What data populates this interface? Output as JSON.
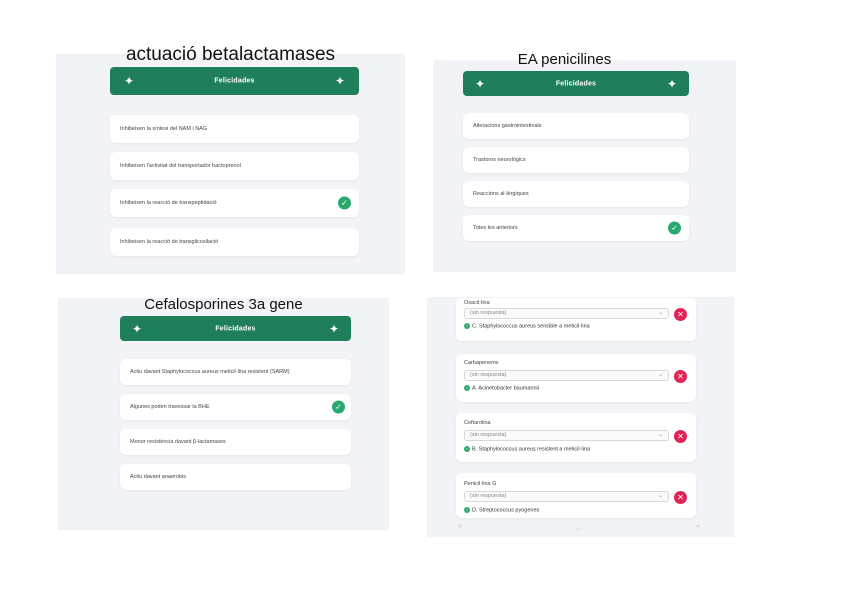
{
  "panel1": {
    "title": "actuació betalactamases",
    "banner": "Felicidades",
    "options": [
      {
        "text": "Inhibeixen la síntesi del NAM i NAG",
        "correct": false
      },
      {
        "text": "Inhibeixen l'activitat del transportador bactoprenol",
        "correct": false
      },
      {
        "text": "Inhibeixen la reacció de transpeptidació",
        "correct": true
      },
      {
        "text": "Inhibeixen la reacció de transglicosilació",
        "correct": false
      }
    ]
  },
  "panel2": {
    "title": "EA penicilines",
    "banner": "Felicidades",
    "options": [
      {
        "text": "Alteracions gastrointestinals",
        "correct": false
      },
      {
        "text": "Trastorns neurològics",
        "correct": false
      },
      {
        "text": "Reaccions al·lèrgiques",
        "correct": false
      },
      {
        "text": "Totes les anteriors",
        "correct": true
      }
    ]
  },
  "panel3": {
    "title": "Cefalosporines 3a gene",
    "banner": "Felicidades",
    "options": [
      {
        "text": "Actiu davant Staphylococcus aureus meticil·lina resistent (SARM)",
        "correct": false
      },
      {
        "text": "Algunes poden travessar la BHE",
        "correct": true
      },
      {
        "text": "Menor resistència davant β-lactamases",
        "correct": false
      },
      {
        "text": "Actiu davant anaerobis",
        "correct": false
      }
    ]
  },
  "panel4": {
    "placeholder": "(sin respuesta)",
    "questions": [
      {
        "label": "Oxacil·lina",
        "answer": "C. Staphylococcus aureus sensible a meticil·lina"
      },
      {
        "label": "Carbapenems",
        "answer": "A. Acinetobacter baumannii"
      },
      {
        "label": "Ceftarolina",
        "answer": "B. Staphylococcus aureus resistent a meticil·lina"
      },
      {
        "label": "Penicil·lina G",
        "answer": "D. Streptococcus pyogenes"
      }
    ],
    "nav": [
      "≡",
      "◡",
      "<"
    ]
  },
  "icons": {
    "sparkle": "sparkle-star-icon",
    "check": "check-icon",
    "close": "close-icon",
    "chevron": "chevron-down-icon"
  },
  "colors": {
    "banner": "#1f7f5a",
    "check": "#2aa86f",
    "wrong": "#e02456",
    "panel_bg": "#f2f3f7"
  }
}
